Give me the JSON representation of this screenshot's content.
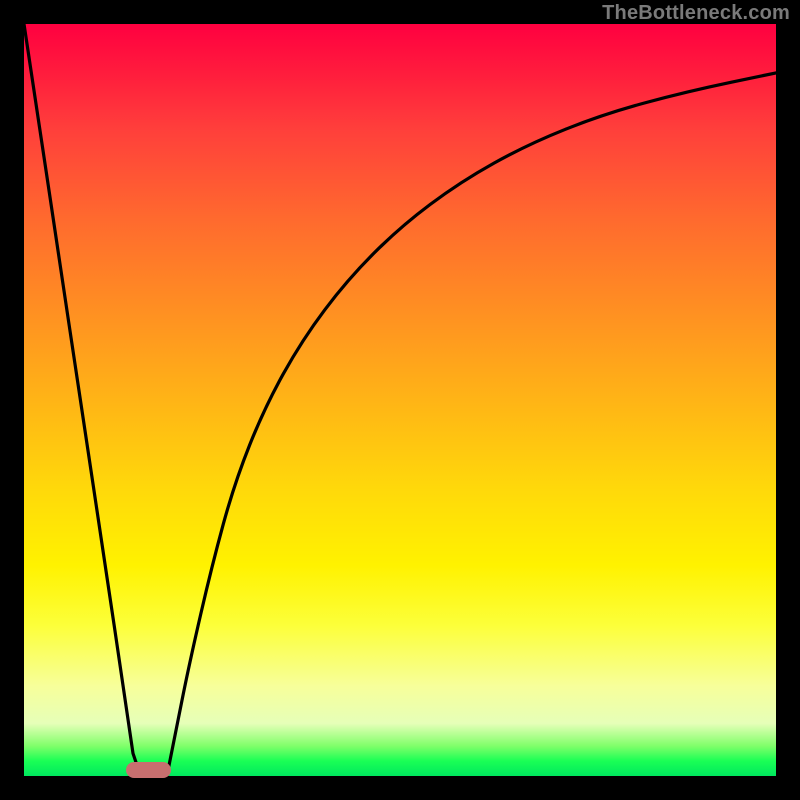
{
  "watermark": "TheBottleneck.com",
  "colors": {
    "frame": "#000000",
    "curve": "#000000",
    "marker": "#c76f6f",
    "gradient_stops": [
      "#ff0040",
      "#ff6a2e",
      "#ffd90a",
      "#fcff3a",
      "#1aff55"
    ]
  },
  "chart_data": {
    "type": "line",
    "title": "",
    "xlabel": "",
    "ylabel": "",
    "xlim": [
      0,
      100
    ],
    "ylim": [
      0,
      100
    ],
    "grid": false,
    "legend": false,
    "series": [
      {
        "name": "left_branch",
        "x": [
          0,
          3,
          6,
          9,
          12,
          14.5,
          15.5
        ],
        "values": [
          100,
          80,
          60,
          40,
          20,
          3,
          0
        ]
      },
      {
        "name": "right_branch",
        "x": [
          19,
          20,
          22,
          25,
          28,
          32,
          37,
          43,
          50,
          58,
          67,
          77,
          88,
          100
        ],
        "values": [
          0,
          5,
          15,
          28,
          39,
          49,
          58,
          66,
          73,
          79,
          84,
          88,
          91,
          93.5
        ]
      }
    ],
    "annotations": [
      {
        "name": "min_marker",
        "shape": "pill",
        "x_range": [
          13.5,
          19.5
        ],
        "y": 0.8
      }
    ]
  }
}
